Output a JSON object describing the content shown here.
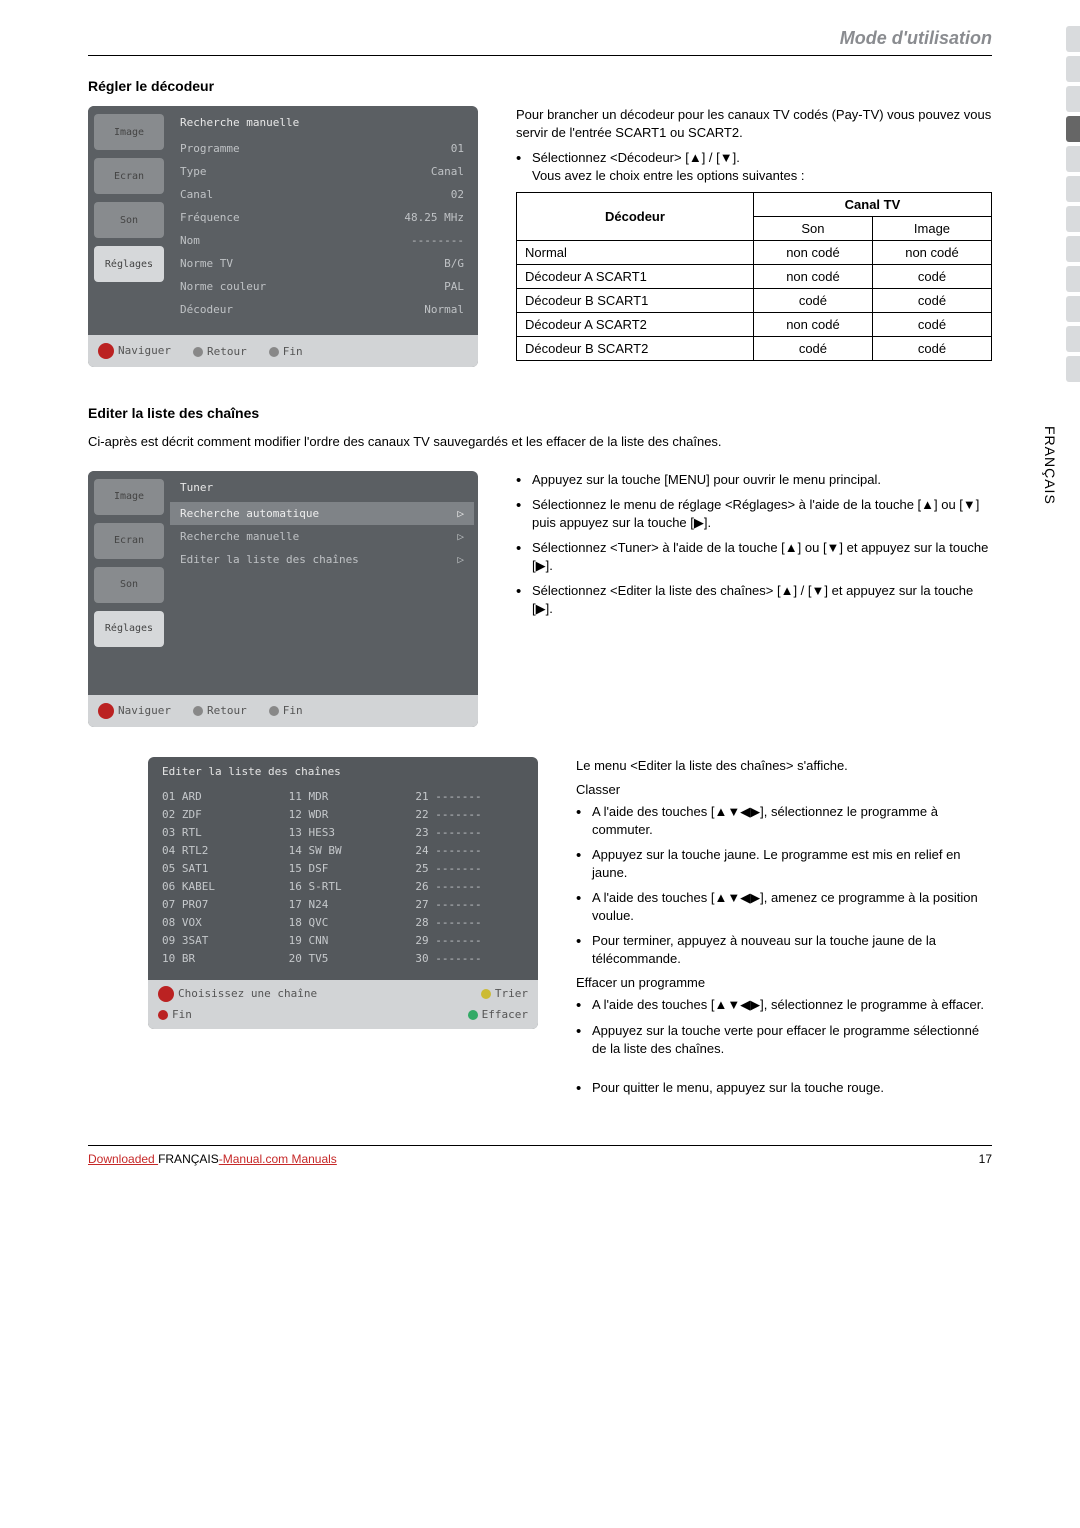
{
  "header": {
    "title": "Mode d'utilisation"
  },
  "sideTab": {
    "vertical_label": "FRANÇAIS"
  },
  "sec1": {
    "title": "Régler le décodeur",
    "osd": {
      "title": "Recherche manuelle",
      "side": [
        "Image",
        "Ecran",
        "Son",
        "Réglages"
      ],
      "rows": [
        {
          "k": "Programme",
          "v": "01"
        },
        {
          "k": "Type",
          "v": "Canal"
        },
        {
          "k": "Canal",
          "v": "02"
        },
        {
          "k": "Fréquence",
          "v": "48.25 MHz"
        },
        {
          "k": "Nom",
          "v": "--------"
        },
        {
          "k": "Norme TV",
          "v": "B/G"
        },
        {
          "k": "Norme couleur",
          "v": "PAL"
        },
        {
          "k": "Décodeur",
          "v": "Normal"
        }
      ],
      "foot": {
        "nav": "Naviguer",
        "ret": "Retour",
        "fin": "Fin"
      }
    },
    "intro": "Pour brancher un décodeur pour les canaux TV codés (Pay-TV) vous pouvez vous servir de l'entrée SCART1 ou SCART2.",
    "step1": "Sélectionnez <Décodeur> [▲] / [▼].",
    "step1b": "Vous avez le choix entre les options suivantes :",
    "table": {
      "h_dec": "Décodeur",
      "h_canal": "Canal TV",
      "h_son": "Son",
      "h_img": "Image",
      "rows": [
        {
          "d": "Normal",
          "s": "non codé",
          "i": "non codé"
        },
        {
          "d": "Décodeur A SCART1",
          "s": "non codé",
          "i": "codé"
        },
        {
          "d": "Décodeur B SCART1",
          "s": "codé",
          "i": "codé"
        },
        {
          "d": "Décodeur A SCART2",
          "s": "non codé",
          "i": "codé"
        },
        {
          "d": "Décodeur B SCART2",
          "s": "codé",
          "i": "codé"
        }
      ]
    }
  },
  "sec2": {
    "title": "Editer la liste des chaînes",
    "intro": "Ci-après est décrit comment modifier l'ordre des canaux TV sauvegardés et les effacer de la liste des chaînes.",
    "osd": {
      "title": "Tuner",
      "side": [
        "Image",
        "Ecran",
        "Son",
        "Réglages"
      ],
      "rows": [
        {
          "k": "Recherche automatique",
          "v": "▷",
          "sel": true
        },
        {
          "k": "Recherche manuelle",
          "v": "▷"
        },
        {
          "k": "Editer la liste des chaînes",
          "v": "▷"
        }
      ],
      "foot": {
        "nav": "Naviguer",
        "ret": "Retour",
        "fin": "Fin"
      }
    },
    "steps": [
      "Appuyez sur la touche [MENU] pour ouvrir le menu principal.",
      "Sélectionnez le menu de réglage <Réglages> à l'aide de la touche [▲] ou [▼] puis appuyez sur la touche [▶].",
      "Sélectionnez <Tuner> à l'aide de la touche [▲] ou [▼] et appuyez sur la touche [▶].",
      "Sélectionnez <Editer la liste des chaînes> [▲] / [▼] et appuyez sur la touche [▶]."
    ]
  },
  "sec3": {
    "chlist": {
      "title": "Editer la liste des chaînes",
      "col1": [
        "01 ARD",
        "02 ZDF",
        "03 RTL",
        "04 RTL2",
        "05 SAT1",
        "06 KABEL",
        "07 PRO7",
        "08 VOX",
        "09 3SAT",
        "10 BR"
      ],
      "col2": [
        "11 MDR",
        "12 WDR",
        "13 HES3",
        "14 SW BW",
        "15 DSF",
        "16 S-RTL",
        "17 N24",
        "18 QVC",
        "19 CNN",
        "20 TV5"
      ],
      "col3": [
        "21 -------",
        "22 -------",
        "23 -------",
        "24 -------",
        "25 -------",
        "26 -------",
        "27 -------",
        "28 -------",
        "29 -------",
        "30 -------"
      ],
      "foot1": "Choisissez une chaîne",
      "foot_trier": "Trier",
      "foot_fin": "Fin",
      "foot_eff": "Effacer"
    },
    "right": {
      "menu_line": "Le menu <Editer la liste des chaînes> s'affiche.",
      "classer": "Classer",
      "classer_steps": [
        "A l'aide des touches [▲▼◀▶], sélectionnez le programme à commuter.",
        "Appuyez sur la touche jaune. Le programme est mis en relief en jaune.",
        "A l'aide des touches [▲▼◀▶], amenez ce programme à la position voulue.",
        "Pour terminer, appuyez à nouveau sur la touche jaune de la télécommande."
      ],
      "effacer": "Effacer un programme",
      "effacer_steps": [
        "A l'aide des touches [▲▼◀▶], sélectionnez le programme à effacer.",
        "Appuyez sur la touche verte pour effacer le programme sélectionné de la liste des chaînes."
      ],
      "quit": "Pour quitter le menu, appuyez sur la touche rouge."
    }
  },
  "footer": {
    "left_pre": "Downloaded ",
    "lang": "FRANÇAIS",
    "left_post": "-Manual.com Manuals",
    "page": "17"
  }
}
